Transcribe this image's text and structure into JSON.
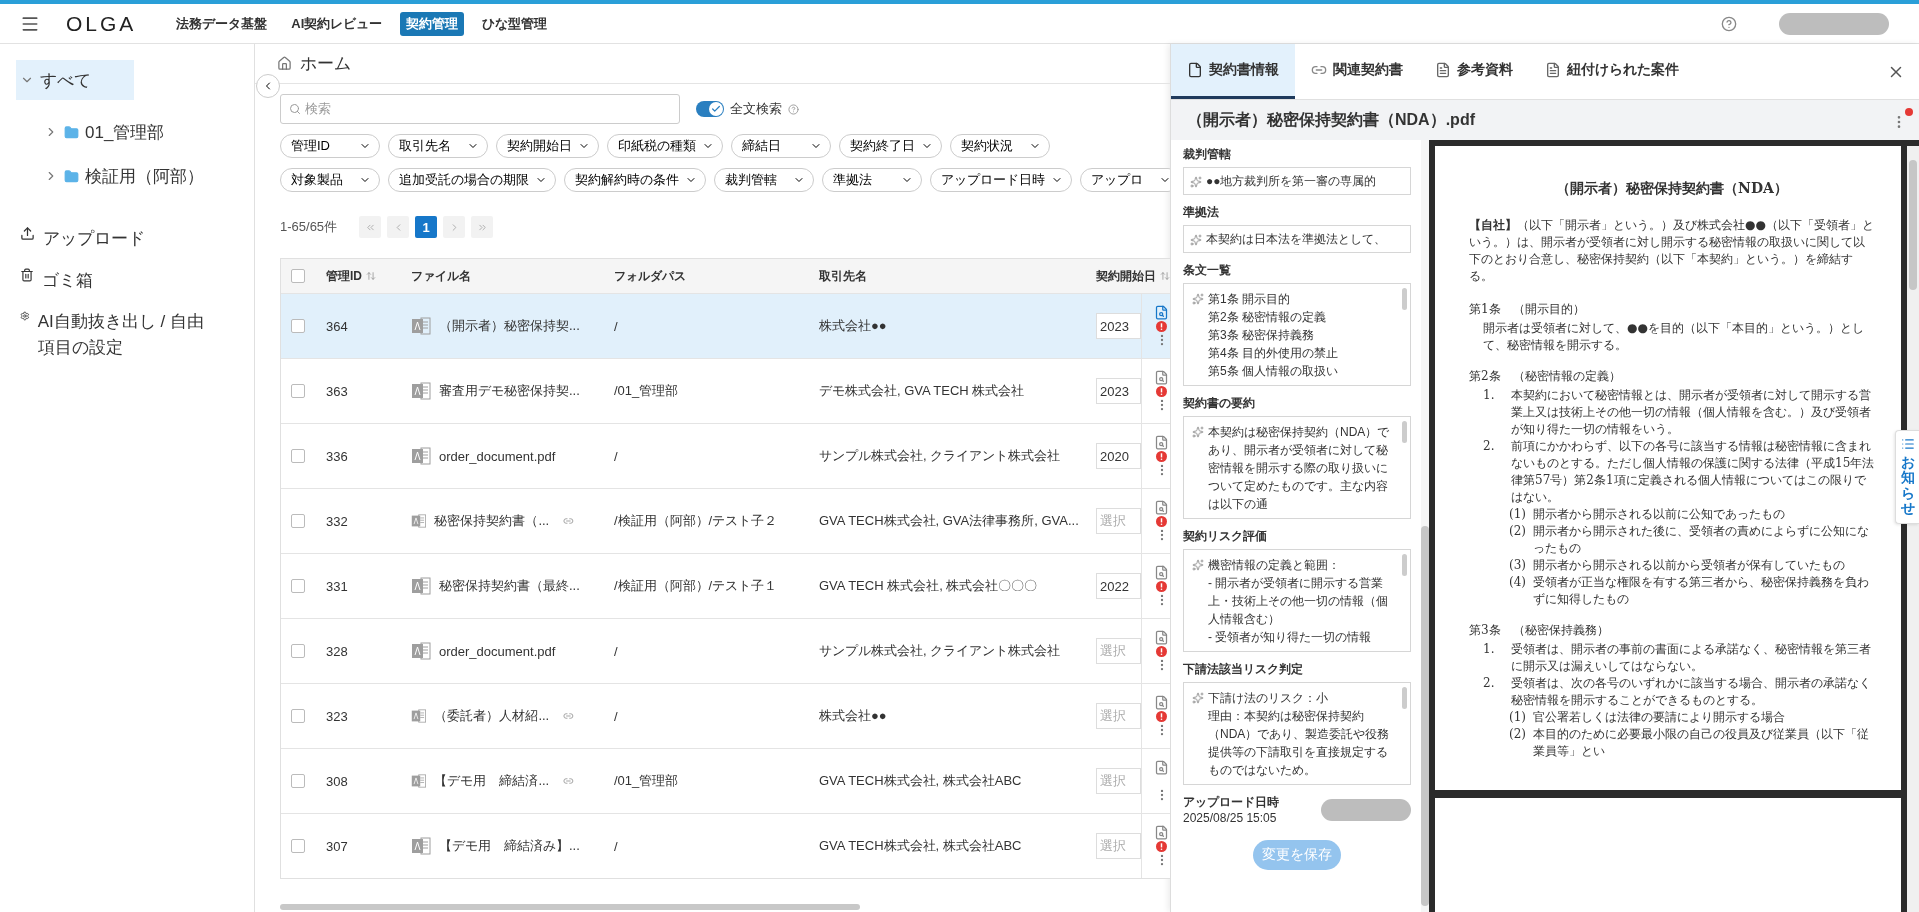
{
  "header": {
    "logo": "OLGA",
    "nav": [
      {
        "label": "法務データ基盤",
        "selected": false
      },
      {
        "label": "AI契約レビュー",
        "selected": false
      },
      {
        "label": "契約管理",
        "selected": true
      },
      {
        "label": "ひな型管理",
        "selected": false
      }
    ]
  },
  "sidebar": {
    "tree": [
      {
        "label": "すべて",
        "selected": true,
        "expanded": true,
        "children": [
          {
            "label": "01_管理部",
            "selected": false,
            "expanded": false
          },
          {
            "label": "検証用（阿部）",
            "selected": false,
            "expanded": false
          }
        ]
      }
    ],
    "actions": [
      {
        "kind": "upload",
        "label": "アップロード"
      },
      {
        "kind": "trash",
        "label": "ゴミ箱"
      },
      {
        "kind": "settings",
        "label": "AI自動抜き出し / 自由項目の設定"
      }
    ]
  },
  "main": {
    "breadcrumb": "ホーム",
    "search": {
      "placeholder": "検索"
    },
    "fulltext": {
      "label": "全文検索",
      "on": true
    },
    "filters": [
      [
        "管理ID",
        "取引先名",
        "契約開始日",
        "印紙税の種類",
        "締結日",
        "契約終了日",
        "契約状況"
      ],
      [
        "対象製品",
        "追加受託の場合の期限",
        "契約解約時の条件",
        "裁判管轄",
        "準拠法",
        "アップロード日時",
        "アップロ"
      ]
    ],
    "pagination": {
      "range": "1-65/65件",
      "pages": [
        {
          "label": "1",
          "selected": true
        }
      ]
    },
    "table": {
      "all_checked": false,
      "columns": [
        {
          "label": "管理ID",
          "sortable": true
        },
        {
          "label": "ファイル名",
          "sortable": false
        },
        {
          "label": "フォルダパス",
          "sortable": false
        },
        {
          "label": "取引先名",
          "sortable": false
        },
        {
          "label": "契約開始日",
          "sortable": true
        }
      ],
      "rows": [
        {
          "id": "364",
          "file": "（開示者）秘密保持契...",
          "linked": false,
          "folder": "/",
          "partner": "株式会社●●",
          "start_date": {
            "value": "2023"
          },
          "alert": true,
          "selected": true,
          "checked": false
        },
        {
          "id": "363",
          "file": "審査用デモ秘密保持契...",
          "linked": false,
          "folder": "/01_管理部",
          "partner": "デモ株式会社, GVA TECH 株式会社",
          "start_date": {
            "value": "2023"
          },
          "alert": true,
          "selected": false,
          "checked": false
        },
        {
          "id": "336",
          "file": "order_document.pdf",
          "linked": false,
          "folder": "/",
          "partner": "サンプル株式会社, クライアント株式会社",
          "start_date": {
            "value": "2020"
          },
          "alert": true,
          "selected": false,
          "checked": false
        },
        {
          "id": "332",
          "file": "秘密保持契約書（...",
          "linked": true,
          "folder": "/検証用（阿部）/テスト子２",
          "partner": "GVA TECH株式会社, GVA法律事務所, GVA...",
          "start_date": {
            "placeholder": "選択"
          },
          "alert": true,
          "selected": false,
          "checked": false
        },
        {
          "id": "331",
          "file": "秘密保持契約書（最終...",
          "linked": false,
          "folder": "/検証用（阿部）/テスト子１",
          "partner": "GVA TECH 株式会社, 株式会社〇〇〇",
          "start_date": {
            "value": "2022"
          },
          "alert": true,
          "selected": false,
          "checked": false
        },
        {
          "id": "328",
          "file": "order_document.pdf",
          "linked": false,
          "folder": "/",
          "partner": "サンプル株式会社, クライアント株式会社",
          "start_date": {
            "placeholder": "選択"
          },
          "alert": true,
          "selected": false,
          "checked": false
        },
        {
          "id": "323",
          "file": "（委託者）人材紹...",
          "linked": true,
          "folder": "/",
          "partner": "株式会社●●",
          "start_date": {
            "placeholder": "選択"
          },
          "alert": true,
          "selected": false,
          "checked": false
        },
        {
          "id": "308",
          "file": "【デモ用　締結済...",
          "linked": true,
          "folder": "/01_管理部",
          "partner": "GVA TECH株式会社, 株式会社ABC",
          "start_date": {
            "placeholder": "選択"
          },
          "alert": false,
          "selected": false,
          "checked": false
        },
        {
          "id": "307",
          "file": "【デモ用　締結済み】...",
          "linked": false,
          "folder": "/",
          "partner": "GVA TECH株式会社, 株式会社ABC",
          "start_date": {
            "placeholder": "選択"
          },
          "alert": true,
          "selected": false,
          "checked": false
        }
      ]
    }
  },
  "panel": {
    "tabs": [
      {
        "kind": "info",
        "label": "契約書情報",
        "selected": true
      },
      {
        "kind": "link",
        "label": "関連契約書",
        "selected": false
      },
      {
        "kind": "doc",
        "label": "参考資料",
        "selected": false
      },
      {
        "kind": "doc",
        "label": "紐付けられた案件",
        "selected": false
      }
    ],
    "file_title": "（開示者）秘密保持契約書（NDA）.pdf",
    "menu_alert": true,
    "fields": [
      {
        "kind": "line",
        "label": "裁判管轄",
        "lines": [
          "●●地方裁判所を第一審の専属的"
        ]
      },
      {
        "kind": "line",
        "label": "準拠法",
        "lines": [
          "本契約は日本法を準拠法として、"
        ]
      },
      {
        "kind": "multiline",
        "label": "条文一覧",
        "lines": [
          "第1条 開示目的",
          "第2条 秘密情報の定義",
          "第3条 秘密保持義務",
          "第4条 目的外使用の禁止",
          "第5条 個人情報の取扱い"
        ]
      },
      {
        "kind": "multiline",
        "label": "契約書の要約",
        "lines": [
          "本契約は秘密保持契約（NDA）であり、開示者が受領者に対して秘密情報を開示する際の取り扱いについて定めたものです。主な内容は以下の通"
        ]
      },
      {
        "kind": "multiline",
        "label": "契約リスク評価",
        "lines": [
          "機密情報の定義と範囲：",
          "- 開示者が受領者に開示する営業上・技術上その他一切の情報（個人情報含む）",
          "- 受領者が知り得た一切の情報"
        ]
      },
      {
        "kind": "multiline",
        "label": "下請法該当リスク判定",
        "lines": [
          "下請け法のリスク：小",
          "理由：本契約は秘密保持契約（NDA）であり、製造委託や役務提供等の下請取引を直接規定するものではないため。"
        ]
      }
    ],
    "upload": {
      "label": "アップロード日時",
      "value": "2025/08/25 15:05"
    },
    "save_button": {
      "label": "変更を保存",
      "disabled": true
    },
    "document": {
      "title": "（開示者）秘密保持契約書（NDA）",
      "intro": "**【自社】**（以下「開示者」という。）及び株式会社●●（以下「受領者」という。）は、開示者が受領者に対し開示する秘密情報の取扱いに関して以下のとおり合意し、秘密保持契約（以下「本契約」という。）を締結する。",
      "articles": [
        {
          "heading": "第1条　（開示目的）",
          "body": "開示者は受領者に対して、●●を目的（以下「本目的」という。）として、秘密情報を開示する。"
        },
        {
          "heading": "第2条　（秘密情報の定義）",
          "items": [
            {
              "number": "1.",
              "text": "本契約において秘密情報とは、開示者が受領者に対して開示する営業上又は技術上その他一切の情報（個人情報を含む。）及び受領者が知り得た一切の情報をいう。"
            },
            {
              "number": "2.",
              "text": "前項にかかわらず、以下の各号に該当する情報は秘密情報に含まれないものとする。ただし個人情報の保護に関する法律（平成15年法律第57号）第2条1項に定義される個人情報についてはこの限りではない。",
              "subitems": [
                {
                  "number": "(1)",
                  "text": "開示者から開示される以前に公知であったもの"
                },
                {
                  "number": "(2)",
                  "text": "開示者から開示された後に、受領者の責めによらずに公知になったもの"
                },
                {
                  "number": "(3)",
                  "text": "開示者から開示される以前から受領者が保有していたもの"
                },
                {
                  "number": "(4)",
                  "text": "受領者が正当な権限を有する第三者から、秘密保持義務を負わずに知得したもの"
                }
              ]
            }
          ]
        },
        {
          "heading": "第3条　（秘密保持義務）",
          "items": [
            {
              "number": "1.",
              "text": "受領者は、開示者の事前の書面による承諾なく、秘密情報を第三者に開示又は漏えいしてはならない。"
            },
            {
              "number": "2.",
              "text": "受領者は、次の各号のいずれかに該当する場合、開示者の承諾なく秘密情報を開示することができるものとする。",
              "subitems": [
                {
                  "number": "(1)",
                  "text": "官公署若しくは法律の要請により開示する場合"
                },
                {
                  "number": "(2)",
                  "text": "本目的のために必要最小限の自己の役員及び従業員（以下「従業員等」とい"
                }
              ]
            }
          ]
        }
      ]
    }
  },
  "notice_tab": {
    "label": "お知らせ"
  }
}
